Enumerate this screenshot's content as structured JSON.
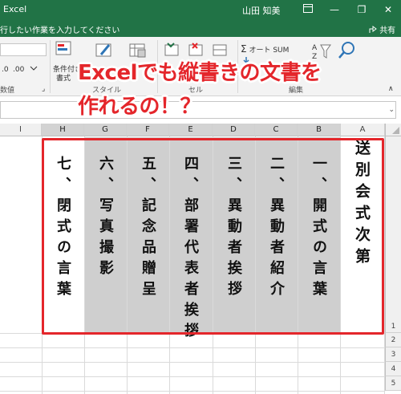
{
  "titlebar": {
    "app_title": "Excel",
    "user_name": "山田 知美",
    "ribbon_display_icon": "ribbon-display-icon",
    "minimize": "—",
    "restore": "❐",
    "close": "✕"
  },
  "tellme": {
    "text": "行したい作業を入力してください",
    "share_label": "共有"
  },
  "ribbon": {
    "number_format_value": "",
    "conditional_format_label": "条件付き",
    "format_label": "書式",
    "group_number_label": "数値",
    "group_style_label": "スタイル",
    "group_cells_label": "セル",
    "group_edit_label": "編集",
    "autosum_label": "オート SUM"
  },
  "caption": {
    "line1": "Excelでも縦書きの文書を",
    "line2": "作れるの！？"
  },
  "grid": {
    "columns": [
      "I",
      "H",
      "G",
      "F",
      "E",
      "D",
      "C",
      "B",
      "A"
    ],
    "rows": [
      "1",
      "2",
      "3",
      "4",
      "5"
    ],
    "cells": {
      "A": "送別会式次第",
      "B": "一、開式の言葉",
      "C": "二、異動者紹介",
      "D": "三、異動者挨拶",
      "E": "四、部署代表者挨拶",
      "F": "五、記念品贈呈",
      "G": "六、写真撮影",
      "H": "七、閉式の言葉"
    }
  },
  "colors": {
    "excel_green": "#217346",
    "highlight_red": "#e4262b",
    "selected_gray": "#cfcfcf"
  }
}
